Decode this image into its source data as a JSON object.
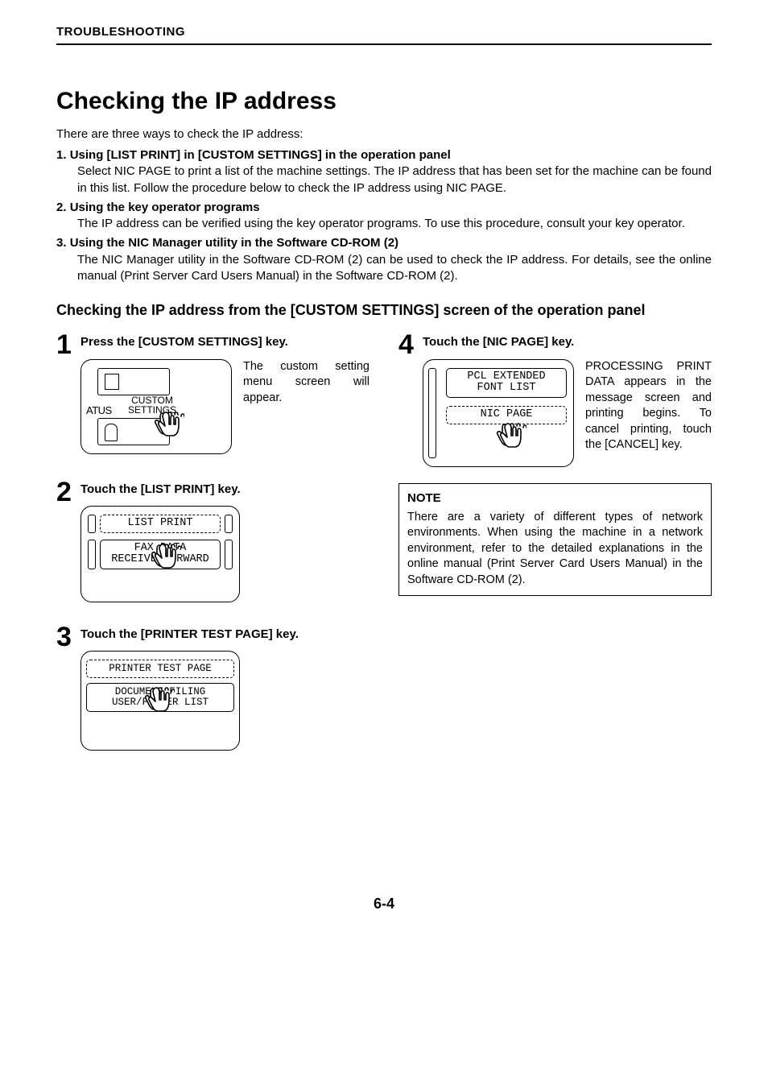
{
  "header": {
    "chapter": "TROUBLESHOOTING"
  },
  "title": "Checking the IP address",
  "intro": "There are three ways to check the IP address:",
  "methods": [
    {
      "title": "Using [LIST PRINT] in [CUSTOM SETTINGS] in the operation panel",
      "body": "Select NIC PAGE to print a list of the machine settings. The IP address that has been set for the machine can be found in this list. Follow the procedure below to check the IP address using NIC PAGE."
    },
    {
      "title": "Using the key operator programs",
      "body": "The IP address can be verified using the key operator programs. To use this procedure, consult your key operator."
    },
    {
      "title": "Using the NIC Manager utility in the Software CD-ROM (2)",
      "body": "The NIC Manager utility in the Software CD-ROM (2) can be used to check the IP address. For details, see the online manual (Print Server Card Users Manual) in the Software CD-ROM (2)."
    }
  ],
  "subhead": "Checking the IP address from the [CUSTOM SETTINGS] screen of the operation panel",
  "steps": {
    "s1": {
      "num": "1",
      "title": "Press the [CUSTOM SETTINGS] key.",
      "text": "The custom setting menu screen will appear.",
      "screen": {
        "partial": "ATUS",
        "button": "CUSTOM\nSETTINGS"
      }
    },
    "s2": {
      "num": "2",
      "title": "Touch the [LIST PRINT] key.",
      "screen": {
        "btn1": "LIST PRINT",
        "btn2": "FAX DATA\nRECEIVE/FORWARD"
      }
    },
    "s3": {
      "num": "3",
      "title": "Touch the [PRINTER TEST PAGE] key.",
      "screen": {
        "btn1": "PRINTER TEST PAGE",
        "btn2": "DOCUMENT FILING\nUSER/FOLDER LIST"
      }
    },
    "s4": {
      "num": "4",
      "title": "Touch the [NIC PAGE] key.",
      "text": "PROCESSING PRINT DATA appears in the message screen and printing begins. To cancel printing, touch the [CANCEL] key.",
      "screen": {
        "btn1": "PCL EXTENDED\nFONT LIST",
        "btn2": "NIC PAGE"
      }
    }
  },
  "note": {
    "title": "NOTE",
    "body": "There are a variety of different types of network environments. When using the machine in a network environment, refer to the detailed explanations in the online manual (Print Server Card Users Manual) in the Software CD-ROM (2)."
  },
  "pagenum": "6-4"
}
